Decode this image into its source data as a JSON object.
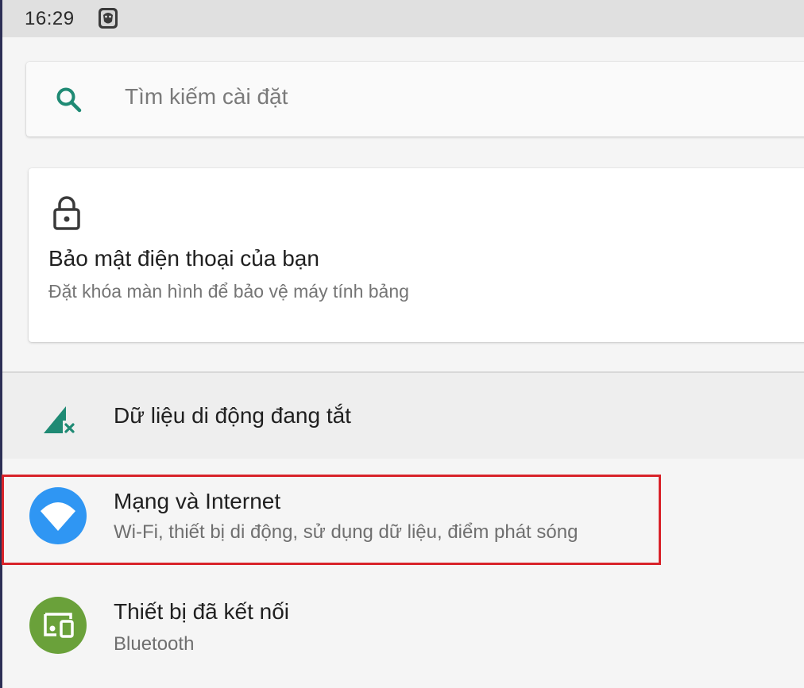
{
  "status_bar": {
    "time": "16:29",
    "notification_icon": "character-notification-icon"
  },
  "search": {
    "icon": "search-icon",
    "placeholder": "Tìm kiếm cài đặt",
    "accent_color": "#1f8a74"
  },
  "security_suggestion": {
    "icon": "lock-icon",
    "title": "Bảo mật điện thoại của bạn",
    "subtitle": "Đặt khóa màn hình để bảo vệ máy tính bảng"
  },
  "mobile_data_banner": {
    "icon": "signal-off-icon",
    "label": "Dữ liệu di động đang tắt",
    "icon_color": "#1f8a74"
  },
  "settings": [
    {
      "icon": "wifi-icon",
      "icon_bg": "#2f96f3",
      "title": "Mạng và Internet",
      "subtitle": "Wi-Fi, thiết bị di động, sử dụng dữ liệu, điểm phát sóng",
      "highlighted": true
    },
    {
      "icon": "connected-devices-icon",
      "icon_bg": "#6aa13a",
      "title": "Thiết bị đã kết nối",
      "subtitle": "Bluetooth",
      "highlighted": false
    }
  ],
  "highlight_color": "#d8232a"
}
